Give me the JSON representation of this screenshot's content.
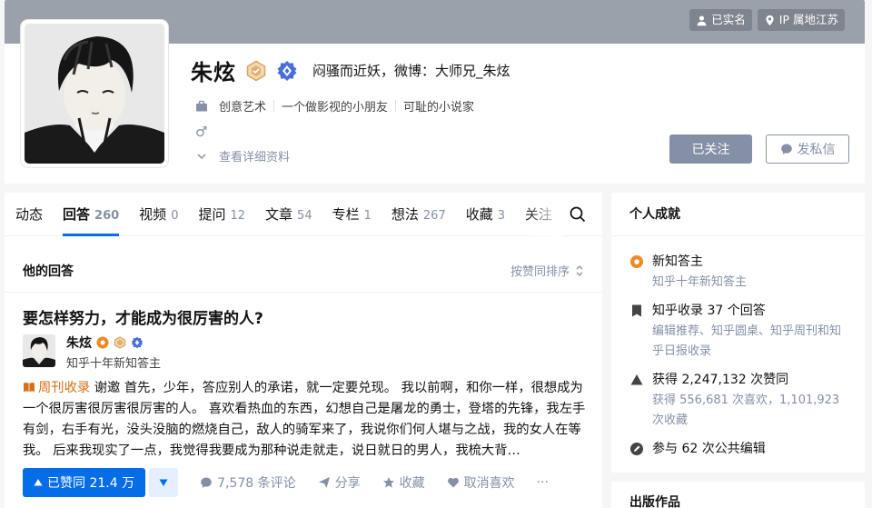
{
  "cover": {
    "tags": [
      "已实名",
      "IP 属地江苏"
    ]
  },
  "profile": {
    "name": "朱炫",
    "headline": "闷骚而近妖，微博：大师兄_朱炫",
    "info": {
      "career": [
        "创意艺术",
        "一个做影视的小朋友",
        "可耻的小说家"
      ],
      "gender_symbol": "♂",
      "details_link": "查看详细资料"
    },
    "buttons": {
      "followed": "已关注",
      "message": "发私信"
    }
  },
  "tabs": [
    {
      "label": "动态",
      "count": ""
    },
    {
      "label": "回答",
      "count": "260"
    },
    {
      "label": "视频",
      "count": "0"
    },
    {
      "label": "提问",
      "count": "12"
    },
    {
      "label": "文章",
      "count": "54"
    },
    {
      "label": "专栏",
      "count": "1"
    },
    {
      "label": "想法",
      "count": "267"
    },
    {
      "label": "收藏",
      "count": "3"
    },
    {
      "label": "关注",
      "count": ""
    }
  ],
  "section": {
    "title": "他的回答",
    "sort": "按赞同排序"
  },
  "answer": {
    "question": "要怎样努力，才能成为很厉害的人?",
    "author_name": "朱炫",
    "author_desc": "知乎十年新知答主",
    "tag": "周刊收录",
    "excerpt": "谢邀 首先，少年，答应别人的承诺，就一定要兑现。 我以前啊，和你一样，很想成为一个很厉害很厉害很厉害的人。 喜欢看热血的东西，幻想自己是屠龙的勇士，登塔的先锋，我左手有剑，右手有光，没头没脑的燃烧自己，敌人的骑军来了，我说你们何人堪与之战，我的女人在等我。 后来我现实了一点，我觉得我要成为那种说走就走，说日就日的男人，我梳大背…",
    "vote_label": "已赞同 21.4 万",
    "comments": "7,578 条评论",
    "share": "分享",
    "favorite": "收藏",
    "unlike": "取消喜欢",
    "more": "···"
  },
  "achievements": {
    "title": "个人成就",
    "items": [
      {
        "main": "新知答主",
        "sub": "知乎十年新知答主"
      },
      {
        "main": "知乎收录 37 个回答",
        "sub": "编辑推荐、知乎圆桌、知乎周刊和知乎日报收录"
      },
      {
        "main": "获得 2,247,132 次赞同",
        "sub": "获得 556,681 次喜欢，1,101,923 次收藏"
      },
      {
        "main": "参与 62 次公共编辑",
        "sub": ""
      }
    ]
  },
  "publications": {
    "title": "出版作品"
  },
  "colors": {
    "accent": "#056de8",
    "cover": "#9aa1aa",
    "muted": "#8590a6",
    "tag_orange": "#d66f16"
  }
}
